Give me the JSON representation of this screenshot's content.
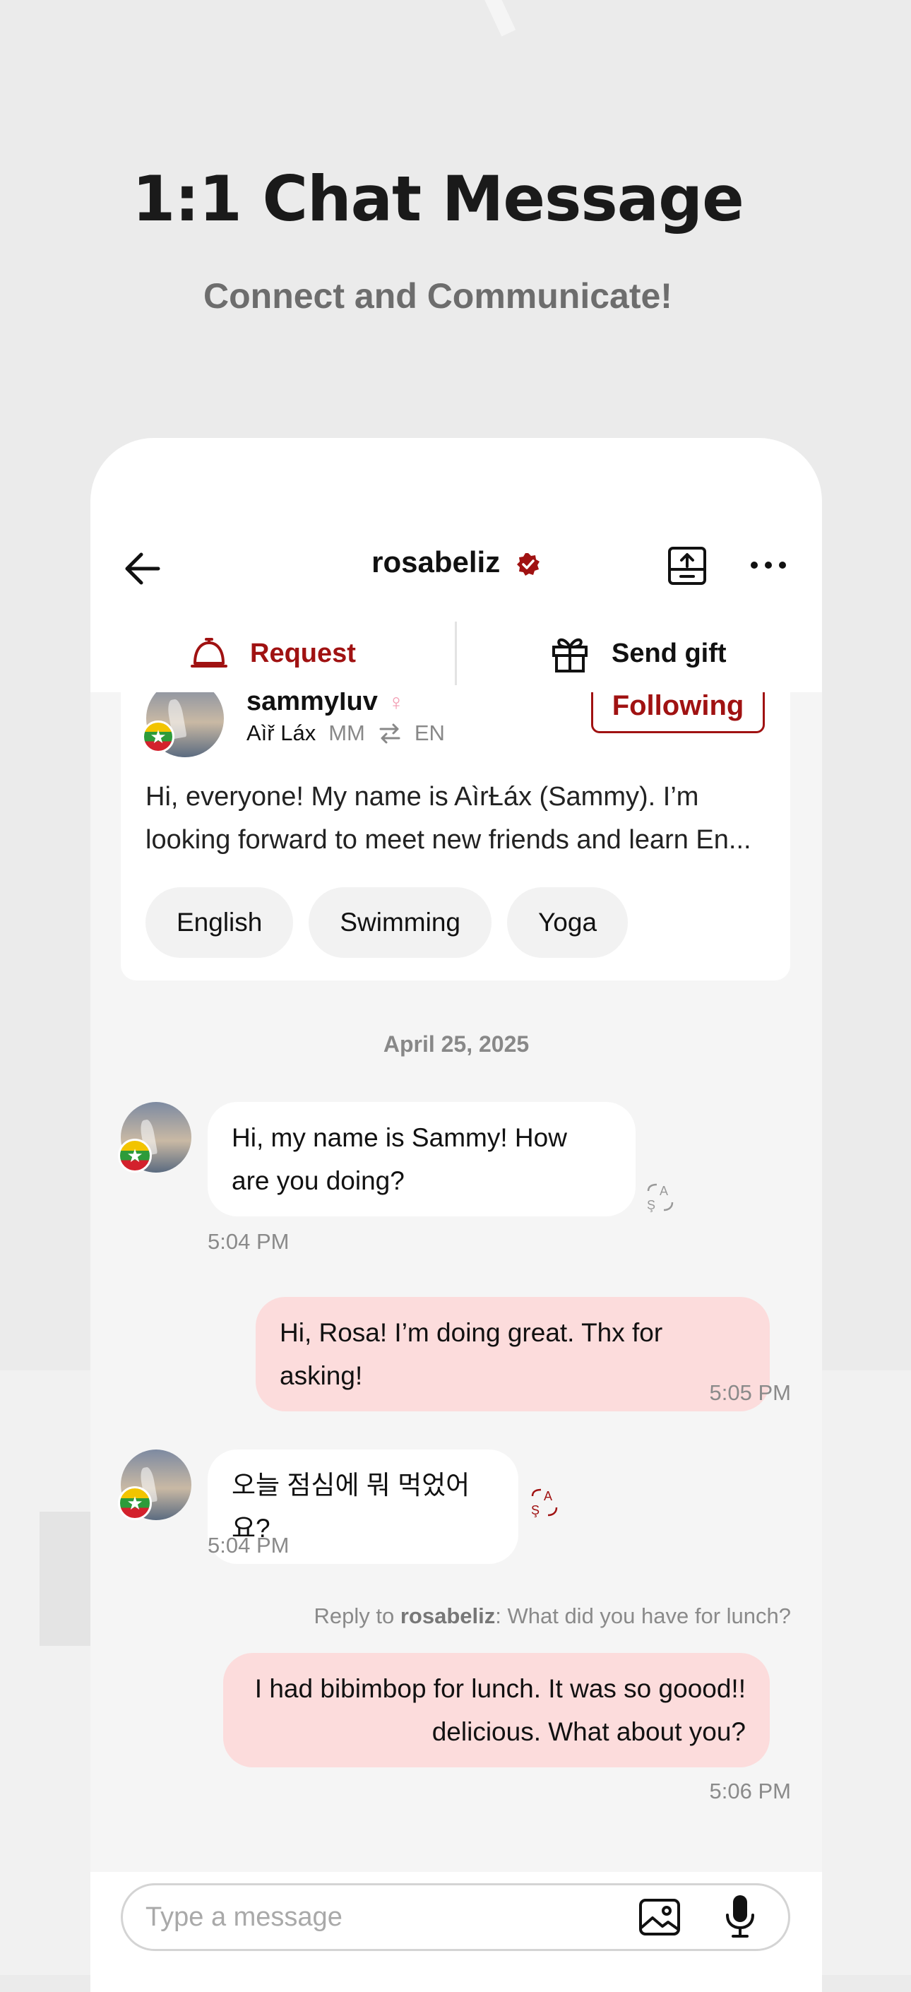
{
  "promo": {
    "title": "1:1 Chat Message",
    "subtitle": "Connect and Communicate!"
  },
  "header": {
    "title": "rosabeliz",
    "icons": [
      "back-arrow-icon",
      "verified-badge-icon",
      "share-icon",
      "more-icon"
    ]
  },
  "actions": {
    "request_label": "Request",
    "gift_label": "Send gift"
  },
  "profile_card": {
    "name": "sammyluv",
    "gender_symbol": "♀",
    "native_name": "Aìř Láx",
    "lang_from": "MM",
    "lang_to": "EN",
    "follow_label": "Following",
    "bio": "Hi, everyone! My name is AìrȽáx (Sammy). I’m looking forward to meet new friends and learn En...",
    "tags": [
      "English",
      "Swimming",
      "Yoga"
    ]
  },
  "chat": {
    "date": "April 25, 2025",
    "messages": [
      {
        "direction": "in",
        "text": "Hi, my name is Sammy! How are you doing?",
        "time": "5:04 PM"
      },
      {
        "direction": "out",
        "text": "Hi, Rosa! I’m doing great. Thx for asking!",
        "time": "5:05 PM"
      },
      {
        "direction": "in",
        "text": "오늘 점심에 뭐 먹었어요?",
        "time": "5:04 PM"
      },
      {
        "direction": "out",
        "text": "I had bibimbop for lunch. It was so goood!! delicious. What about you?",
        "time": "5:06 PM"
      }
    ],
    "reply": {
      "prefix": "Reply to ",
      "user": "rosabeliz",
      "quote": ": What did you have for lunch?"
    }
  },
  "composer": {
    "placeholder": "Type a message"
  },
  "colors": {
    "accent": "#a01212",
    "outgoing_bubble": "#fcdcdc",
    "incoming_bubble": "#ffffff",
    "background": "#f5f5f5"
  }
}
